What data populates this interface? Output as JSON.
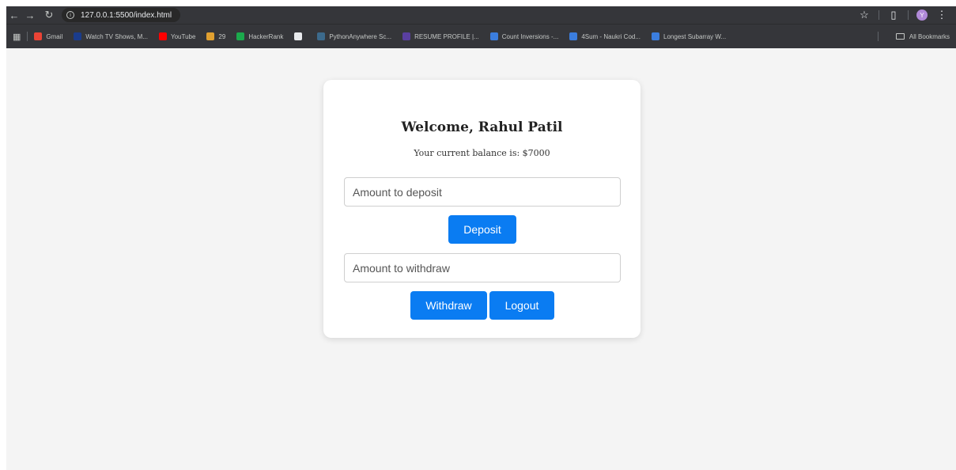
{
  "browser": {
    "url": "127.0.0.1:5500/index.html",
    "bookmarks": [
      {
        "label": "Gmail",
        "color": "#ea4335",
        "icon": "gmail-icon"
      },
      {
        "label": "Watch TV Shows, M...",
        "color": "#1a3c8c",
        "icon": "tv-icon"
      },
      {
        "label": "YouTube",
        "color": "#ff0000",
        "icon": "youtube-icon"
      },
      {
        "label": "29",
        "color": "#e0a030",
        "icon": "coding-icon"
      },
      {
        "label": "HackerRank",
        "color": "#1ba94c",
        "icon": "hackerrank-icon"
      },
      {
        "label": "",
        "color": "#e8eaed",
        "icon": "chatgpt-icon"
      },
      {
        "label": "PythonAnywhere Sc...",
        "color": "#3c6a8c",
        "icon": "python-icon"
      },
      {
        "label": "RESUME PROFILE |...",
        "color": "#5a3fa0",
        "icon": "resume-icon"
      },
      {
        "label": "Count Inversions -...",
        "color": "#3b7ddd",
        "icon": "naukri-icon"
      },
      {
        "label": "4Sum - Naukri Cod...",
        "color": "#3b7ddd",
        "icon": "naukri-icon"
      },
      {
        "label": "Longest Subarray W...",
        "color": "#3b7ddd",
        "icon": "naukri-icon"
      }
    ],
    "all_bookmarks_label": "All Bookmarks",
    "profile_initial": "Y"
  },
  "card": {
    "welcome": "Welcome, Rahul Patil",
    "balance_text": "Your current balance is: $7000",
    "deposit_placeholder": "Amount to deposit",
    "deposit_button": "Deposit",
    "withdraw_placeholder": "Amount to withdraw",
    "withdraw_button": "Withdraw",
    "logout_button": "Logout"
  },
  "colors": {
    "accent": "#0a7cf2",
    "page_bg": "#f4f4f4",
    "chrome_bg": "#35363a"
  }
}
